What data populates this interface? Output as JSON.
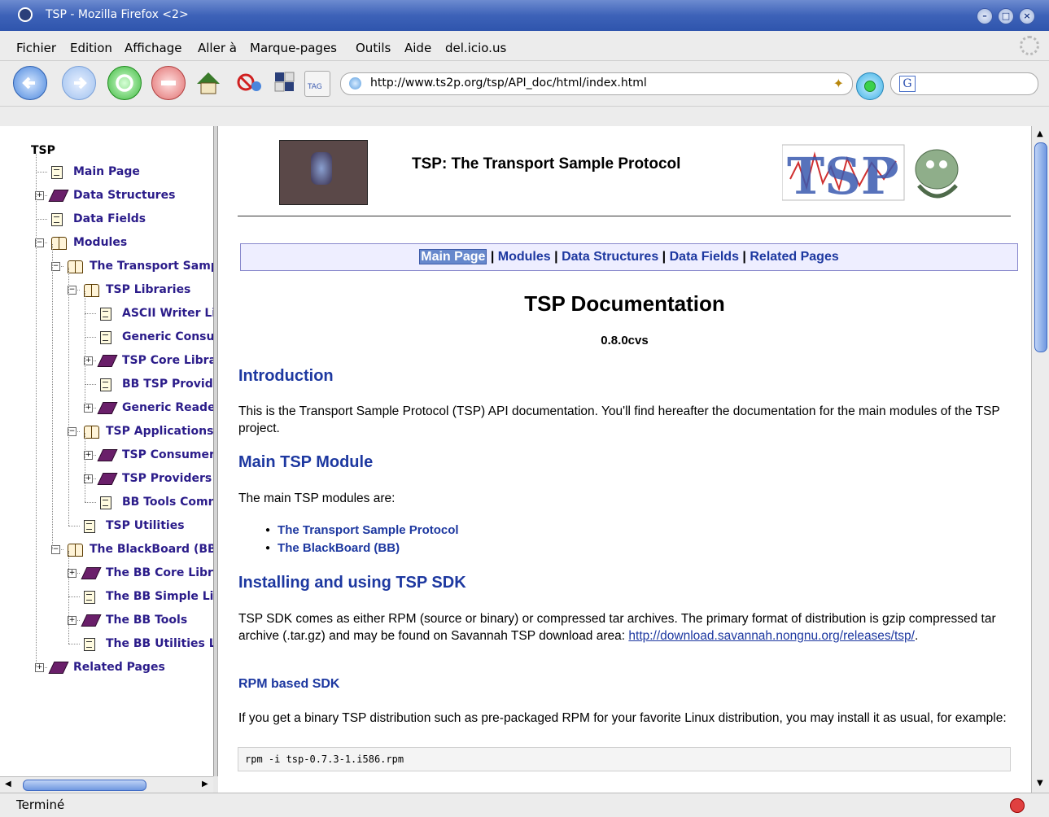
{
  "window": {
    "title": "TSP - Mozilla Firefox <2>"
  },
  "menu": [
    "Fichier",
    "Edition",
    "Affichage",
    "Aller à",
    "Marque-pages",
    "Outils",
    "Aide",
    "del.icio.us"
  ],
  "toolbar": {
    "url": "http://www.ts2p.org/tsp/API_doc/html/index.html",
    "tag_label": "TAG",
    "search_engine_glyph": "G"
  },
  "tree": {
    "root": "TSP",
    "nodes": [
      {
        "label": "Main Page"
      },
      {
        "label": "Data Structures"
      },
      {
        "label": "Data Fields"
      },
      {
        "label": "Modules"
      },
      {
        "label": "The Transport Sample"
      },
      {
        "label": "TSP Libraries"
      },
      {
        "label": "ASCII Writer Lil"
      },
      {
        "label": "Generic Consu"
      },
      {
        "label": "TSP Core Libra"
      },
      {
        "label": "BB TSP Provid"
      },
      {
        "label": "Generic Reader"
      },
      {
        "label": "TSP Applications"
      },
      {
        "label": "TSP Consumer"
      },
      {
        "label": "TSP Providers"
      },
      {
        "label": "BB Tools Comn"
      },
      {
        "label": "TSP Utilities"
      },
      {
        "label": "The BlackBoard (BB)"
      },
      {
        "label": "The BB Core Libra"
      },
      {
        "label": "The BB Simple Lit"
      },
      {
        "label": "The BB Tools"
      },
      {
        "label": "The BB Utilities Li"
      },
      {
        "label": "Related Pages"
      }
    ]
  },
  "content": {
    "site_title": "TSP: The Transport Sample Protocol",
    "nav": [
      "Main Page",
      "Modules",
      "Data Structures",
      "Data Fields",
      "Related Pages"
    ],
    "nav_sep": "|",
    "doc_title": "TSP Documentation",
    "version": "0.8.0cvs",
    "intro_heading": "Introduction",
    "intro_text": "This is the Transport Sample Protocol (TSP) API documentation. You'll find hereafter the documentation for the main modules of the TSP project.",
    "main_heading": "Main TSP Module",
    "main_text": "The main TSP modules are:",
    "modules": [
      "The Transport Sample Protocol",
      "The BlackBoard (BB)"
    ],
    "install_heading": "Installing and using TSP SDK",
    "install_text": "TSP SDK comes as either RPM (source or binary) or compressed tar archives. The primary format of distribution is gzip compressed tar archive (.tar.gz) and may be found on Savannah TSP download area:",
    "install_link": "http://download.savannah.nongnu.org/releases/tsp/",
    "install_after": ".",
    "rpm_heading": "RPM based SDK",
    "rpm_text": "If you get a binary TSP distribution such as pre-packaged RPM for your favorite Linux distribution, you may install it as usual, for example:",
    "rpm_code": "rpm -i tsp-0.7.3-1.i586.rpm"
  },
  "status": {
    "text": "Terminé"
  },
  "colors": {
    "link": "#1d38a0",
    "tree_text": "#2b1c8a",
    "titlebar": "#3d62b8",
    "nav_bg": "#eeeeff"
  }
}
